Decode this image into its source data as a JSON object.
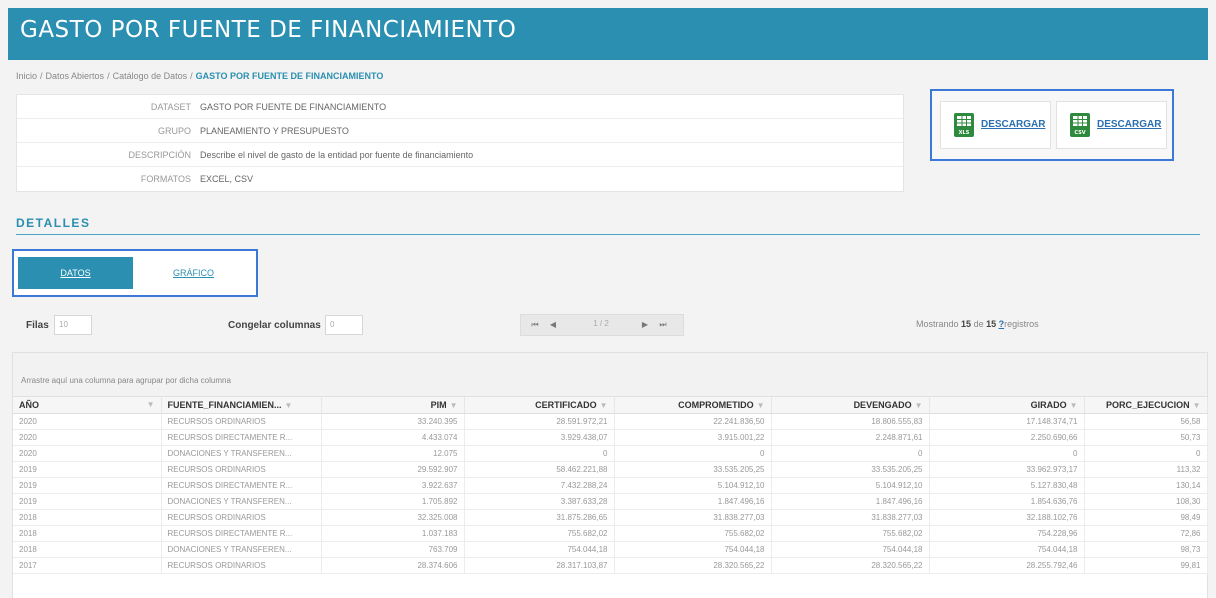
{
  "header": {
    "title": "GASTO POR FUENTE DE FINANCIAMIENTO"
  },
  "breadcrumb": {
    "items": [
      "Inicio",
      "Datos Abiertos",
      "Catálogo de Datos"
    ],
    "separator": "/",
    "current": "GASTO POR FUENTE DE FINANCIAMIENTO"
  },
  "info": {
    "rows": [
      {
        "label": "DATASET",
        "value": "GASTO POR FUENTE DE FINANCIAMIENTO"
      },
      {
        "label": "GRUPO",
        "value": "PLANEAMIENTO Y PRESUPUESTO"
      },
      {
        "label": "DESCRIPCIÓN",
        "value": "Describe el nivel de gasto de la entidad por fuente de financiamiento"
      },
      {
        "label": "FORMATOS",
        "value": "EXCEL, CSV"
      }
    ]
  },
  "downloads": {
    "xls": {
      "label": "DESCARGAR",
      "badge": "XLS"
    },
    "csv": {
      "label": "DESCARGAR",
      "badge": "CSV"
    }
  },
  "section": {
    "title": "DETALLES"
  },
  "tabs": {
    "datos": "DATOS",
    "grafico": "GRÁFICO"
  },
  "controls": {
    "filas_label": "Filas",
    "filas_value": "10",
    "congelar_label": "Congelar columnas",
    "congelar_value": "0",
    "pager_info": "1 / 2"
  },
  "showing": {
    "prefix": "Mostrando",
    "count": "15",
    "mid": "de",
    "total": "15",
    "q": "?",
    "suffix": "registros"
  },
  "grid": {
    "group_hint": "Arrastre aquí una columna para agrupar por dicha columna",
    "columns": [
      "AÑO",
      "FUENTE_FINANCIAMIEN...",
      "PIM",
      "CERTIFICADO",
      "COMPROMETIDO",
      "DEVENGADO",
      "GIRADO",
      "PORC_EJECUCION"
    ],
    "rows": [
      [
        "2020",
        "RECURSOS ORDINARIOS",
        "33.240.395",
        "28.591.972,21",
        "22.241.836,50",
        "18.806.555,83",
        "17.148.374,71",
        "56,58"
      ],
      [
        "2020",
        "RECURSOS DIRECTAMENTE R...",
        "4.433.074",
        "3.929.438,07",
        "3.915.001,22",
        "2.248.871,61",
        "2.250.690,66",
        "50,73"
      ],
      [
        "2020",
        "DONACIONES Y TRANSFEREN...",
        "12.075",
        "0",
        "0",
        "0",
        "0",
        "0"
      ],
      [
        "2019",
        "RECURSOS ORDINARIOS",
        "29.592.907",
        "58.462.221,88",
        "33.535.205,25",
        "33.535.205,25",
        "33.962.973,17",
        "113,32"
      ],
      [
        "2019",
        "RECURSOS DIRECTAMENTE R...",
        "3.922.637",
        "7.432.288,24",
        "5.104.912,10",
        "5.104.912,10",
        "5.127.830,48",
        "130,14"
      ],
      [
        "2019",
        "DONACIONES Y TRANSFEREN...",
        "1.705.892",
        "3.387.633,28",
        "1.847.496,16",
        "1.847.496,16",
        "1.854.636,76",
        "108,30"
      ],
      [
        "2018",
        "RECURSOS ORDINARIOS",
        "32.325.008",
        "31.875.286,65",
        "31.838.277,03",
        "31.838.277,03",
        "32.188.102,76",
        "98,49"
      ],
      [
        "2018",
        "RECURSOS DIRECTAMENTE R...",
        "1.037.183",
        "755.682,02",
        "755.682,02",
        "755.682,02",
        "754.228,96",
        "72,86"
      ],
      [
        "2018",
        "DONACIONES Y TRANSFEREN...",
        "763.709",
        "754.044,18",
        "754.044,18",
        "754.044,18",
        "754.044,18",
        "98,73"
      ],
      [
        "2017",
        "RECURSOS ORDINARIOS",
        "28.374.606",
        "28.317.103,87",
        "28.320.565,22",
        "28.320.565,22",
        "28.255.792,46",
        "99,81"
      ]
    ]
  },
  "colors": {
    "primary": "#2a8fb0",
    "highlight": "#3b78d8",
    "excel_green": "#2e8b3e"
  }
}
